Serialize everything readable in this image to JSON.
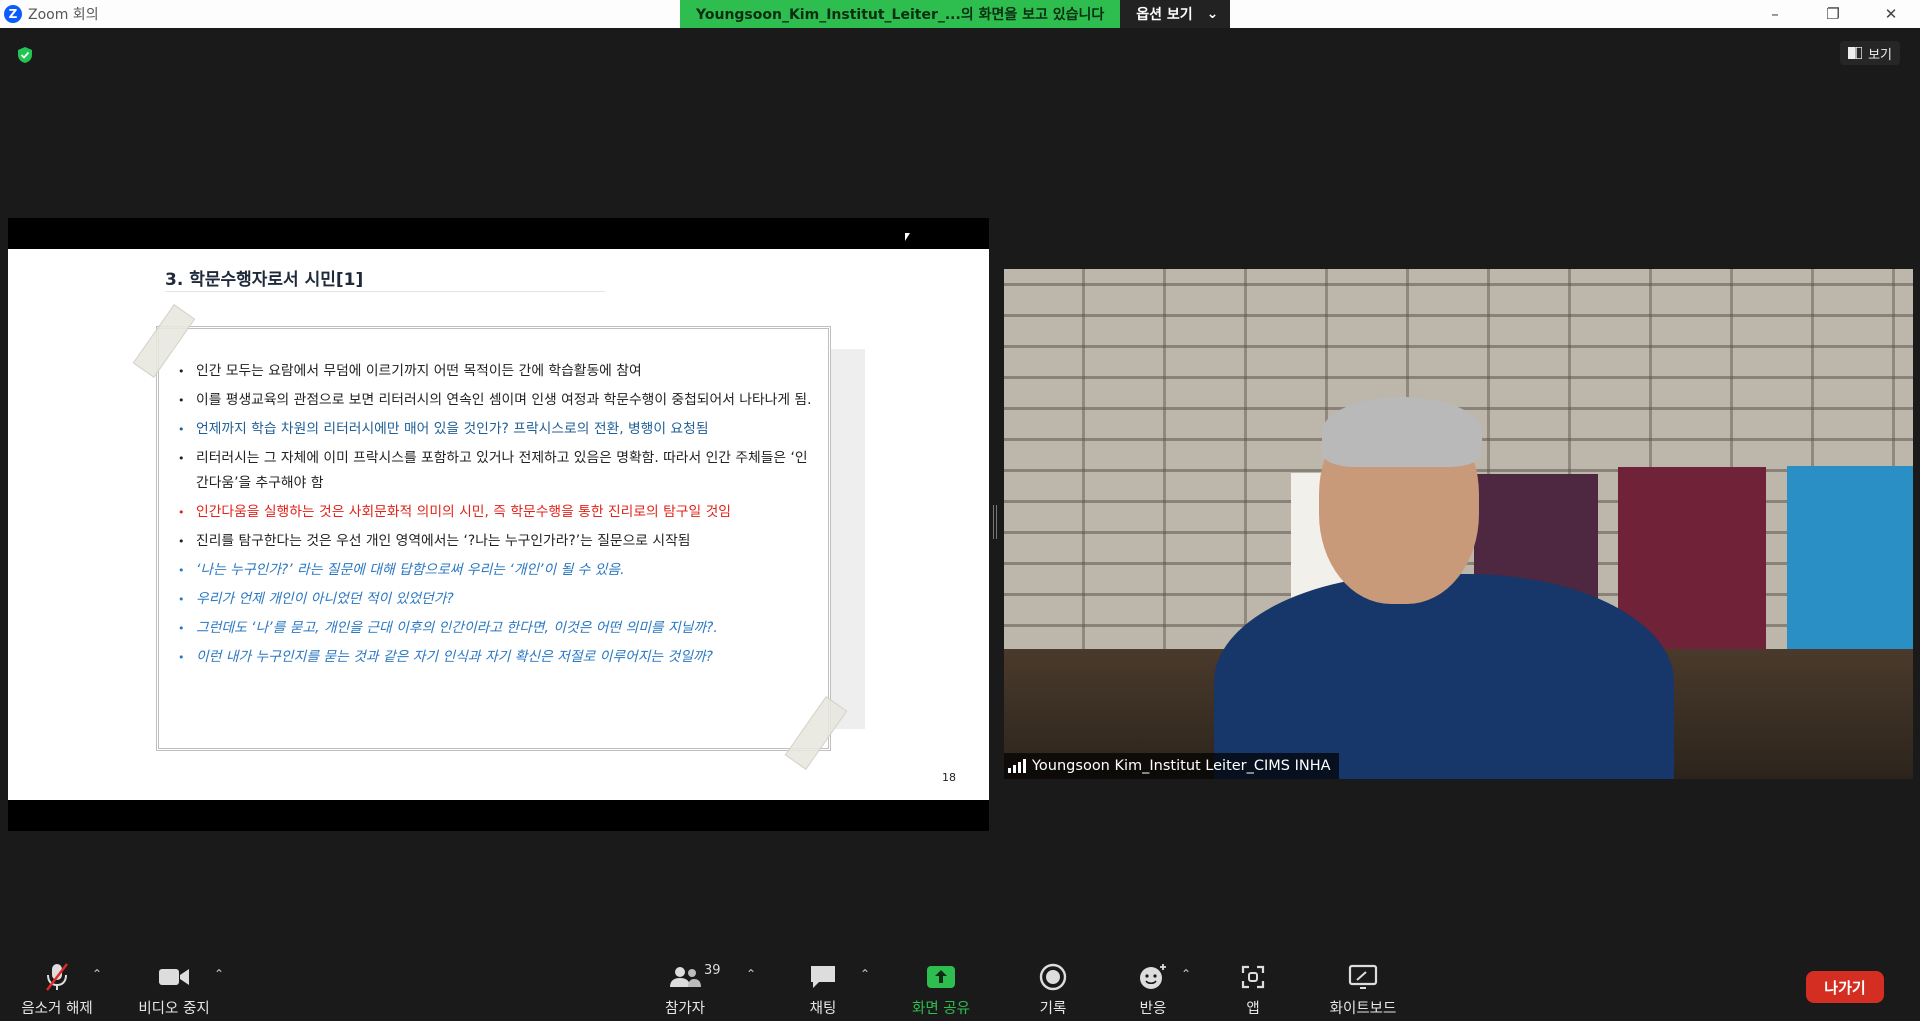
{
  "window": {
    "app_logo": "Z",
    "title": "Zoom 회의",
    "controls": [
      "–",
      "❐",
      "✕"
    ]
  },
  "share_banner": {
    "text": "Youngsoon_Kim_Institut_Leiter_...의 화면을 보고 있습니다",
    "options_label": "옵션 보기",
    "options_caret": "⌄"
  },
  "top_right": {
    "view_label": "보기",
    "view_icon": "sidebar-layout-icon"
  },
  "slide": {
    "title": "3. 학문수행자로서 시민[1]",
    "page_number": "18",
    "bullets": [
      {
        "text": "인간 모두는 요람에서 무덤에 이르기까지 어떤 목적이든 간에 학습활동에 참여",
        "style": "black"
      },
      {
        "text": "이를 평생교육의 관점으로 보면 리터러시의 연속인 셈이며 인생 여정과 학문수행이 중첩되어서 나타나게 됨.",
        "style": "black"
      },
      {
        "text": "언제까지 학습 차원의 리터러시에만 매어 있을 것인가?  프락시스로의 전환, 병행이 요청됨",
        "style": "blue"
      },
      {
        "text": "리터러시는 그 자체에 이미 프락시스를 포함하고 있거나 전제하고 있음은 명확함. 따라서 인간 주체들은 ‘인간다움’을 추구해야 함",
        "style": "black"
      },
      {
        "text": "인간다움을 실행하는 것은 사회문화적 의미의 시민, 즉 학문수행을 통한 진리로의 탐구일 것임",
        "style": "red"
      },
      {
        "text": "진리를 탐구한다는 것은 우선 개인 영역에서는 ‘?나는 누구인가라?’는 질문으로 시작됨",
        "style": "black"
      },
      {
        "text": "‘나는 누구인가?’ 라는 질문에 대해 답함으로써 우리는 ‘개인’이 될 수 있음.",
        "style": "italic"
      },
      {
        "text": "우리가 언제 개인이 아니었던 적이 있었던가?",
        "style": "italic"
      },
      {
        "text": "그런데도 ‘나’를 묻고, 개인을 근대 이후의 인간이라고 한다면, 이것은 어떤 의미를 지닐까?.",
        "style": "italic"
      },
      {
        "text": "이런 내가 누구인지를 묻는 것과 같은 자기 인식과 자기 확신은 저절로 이루어지는 것일까?",
        "style": "italic"
      }
    ]
  },
  "video": {
    "participant_name": "Youngsoon Kim_Institut Leiter_CIMS INHA"
  },
  "toolbar": {
    "mute_label": "음소거 해제",
    "video_label": "비디오 중지",
    "participants_label": "참가자",
    "participants_count": "39",
    "chat_label": "채팅",
    "share_label": "화면 공유",
    "record_label": "기록",
    "reactions_label": "반응",
    "apps_label": "앱",
    "whiteboard_label": "화이트보드",
    "leave_label": "나가기",
    "caret": "⌃"
  },
  "colors": {
    "banner_green": "#2dbe4f",
    "leave_red": "#d42d22",
    "zoom_blue": "#0b5cff"
  }
}
